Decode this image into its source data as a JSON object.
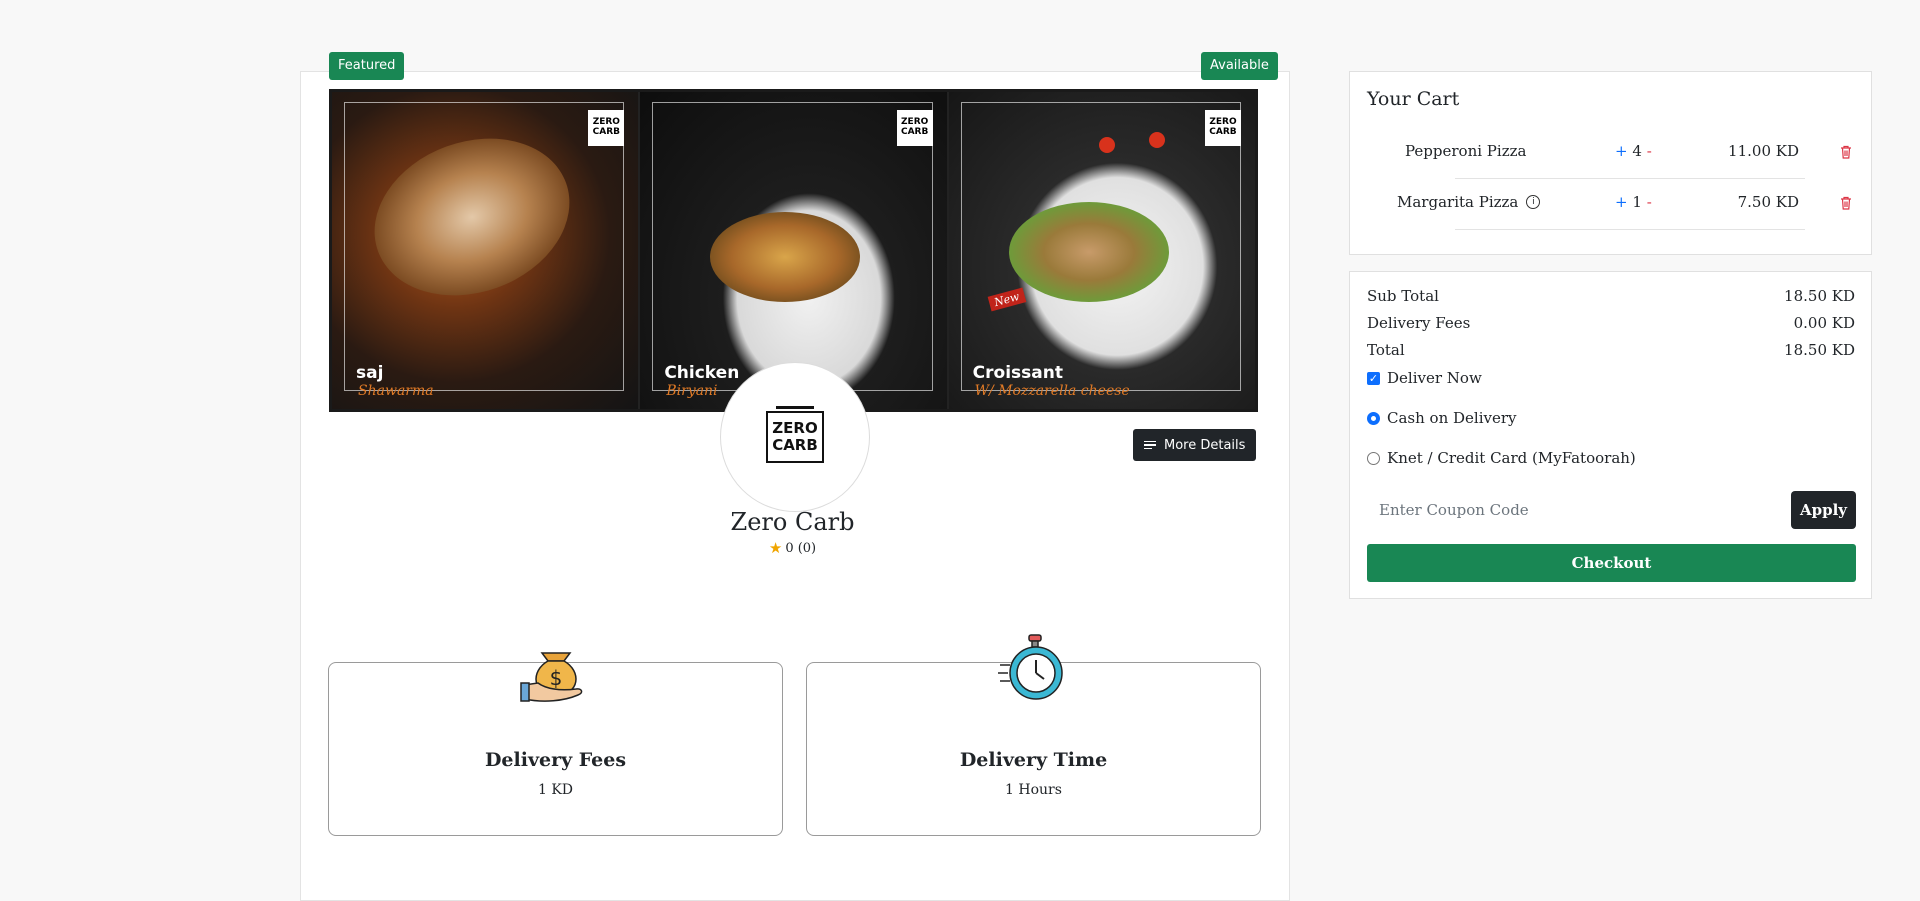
{
  "restaurant": {
    "featured_badge": "Featured",
    "available_badge": "Available",
    "name": "Zero Carb",
    "logo_line1": "ZERO",
    "logo_line2": "CARB",
    "rating": "0 (0)",
    "more_details_label": "More Details",
    "banner_panels": [
      {
        "title": "saj",
        "subtitle": "Shawarma"
      },
      {
        "title": "Chicken",
        "subtitle": "Biryani"
      },
      {
        "title": "Croissant",
        "subtitle": "W/ Mozzarella cheese",
        "tag": "New"
      }
    ],
    "delivery_fees": {
      "title": "Delivery Fees",
      "value": "1 KD"
    },
    "delivery_time": {
      "title": "Delivery Time",
      "value": "1 Hours"
    }
  },
  "cart": {
    "title": "Your Cart",
    "items": [
      {
        "name": "Pepperoni Pizza",
        "plus": "+",
        "qty": "4",
        "minus": "-",
        "price": "11.00 KD"
      },
      {
        "name": "Margarita Pizza",
        "plus": "+",
        "qty": "1",
        "minus": "-",
        "price": "7.50 KD"
      }
    ]
  },
  "summary": {
    "subtotal_label": "Sub Total",
    "subtotal_value": "18.50 KD",
    "delivery_label": "Delivery Fees",
    "delivery_value": "0.00 KD",
    "total_label": "Total",
    "total_value": "18.50 KD",
    "deliver_now_label": "Deliver Now",
    "payment_options": [
      "Cash on Delivery",
      "Knet / Credit Card (MyFatoorah)"
    ],
    "selected_payment": "Cash on Delivery",
    "coupon_placeholder": "Enter Coupon Code",
    "apply_label": "Apply",
    "checkout_label": "Checkout"
  },
  "colors": {
    "green": "#198754",
    "dark": "#212529",
    "blue": "#0d6efd",
    "red": "#dc3545",
    "star": "#f0a500"
  }
}
